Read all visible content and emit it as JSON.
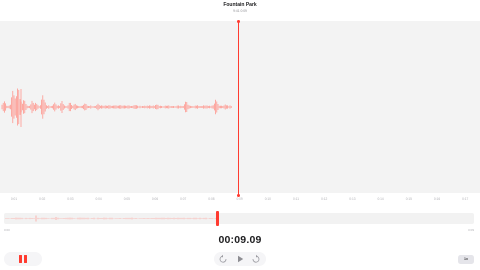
{
  "header": {
    "title": "Fountain Park",
    "subtitle": "9:41 0:09"
  },
  "timeline": {
    "tick_labels": [
      "0:01",
      "0:02",
      "0:03",
      "0:04",
      "0:05",
      "0:06",
      "0:07",
      "0:08",
      "0:09",
      "0:10",
      "0:11",
      "0:12",
      "0:13",
      "0:14",
      "0:15",
      "0:16",
      "0:17"
    ]
  },
  "overview": {
    "start_label": "0:00",
    "end_label": "0:09"
  },
  "timer": "00:09.09",
  "controls": {
    "pause_label": "Pause",
    "rewind_label": "Skip back 15 seconds",
    "play_label": "Play",
    "forward_label": "Skip forward 15 seconds",
    "speed_label": "1x"
  },
  "colors": {
    "accent": "#ff3b30",
    "waveform": "#ff8a80",
    "panel": "#f3f3f3"
  },
  "icons": {
    "pause": "pause-icon",
    "rewind": "skip-back-icon",
    "play": "play-icon",
    "forward": "skip-forward-icon"
  }
}
